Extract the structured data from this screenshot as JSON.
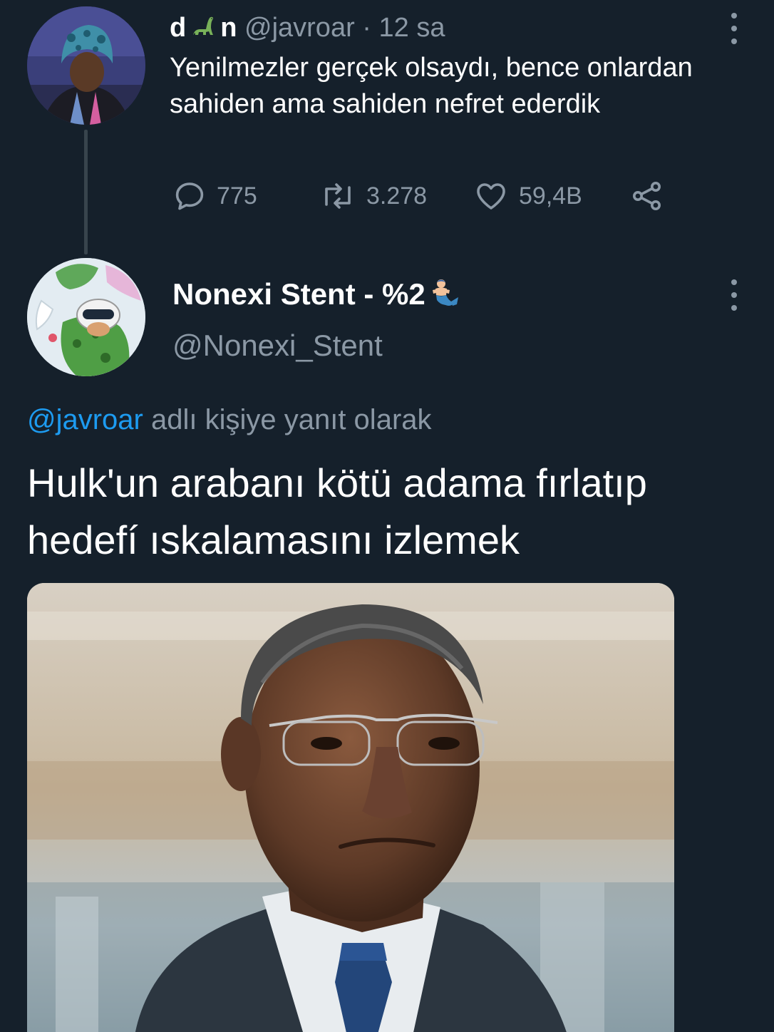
{
  "parent_tweet": {
    "name_start": "d",
    "name_emoji": "sauropod-dinosaur-icon",
    "name_end": "n",
    "handle": "@javroar",
    "separator": "·",
    "time": "12 sa",
    "text": "Yenilmezler gerçek olsaydı, bence onlardan sahiden ama sahiden nefret ederdik",
    "stats": {
      "replies": "775",
      "retweets": "3.278",
      "likes": "59,4B"
    }
  },
  "reply_tweet": {
    "name": "Nonexi Stent - %2",
    "name_emoji": "merman-icon",
    "handle": "@Nonexi_Stent",
    "reply_mention": "@javroar",
    "reply_suffix": " adlı kişiye yanıt olarak",
    "text": "Hulk'un arabanı kötü adama fırlatıp hedefí ıskalamasını izlemek",
    "media": "photo of a serious man in a dark suit and glasses in an office"
  },
  "colors": {
    "background": "#15202b",
    "secondary_text": "#8b98a5",
    "link": "#1d9bf0",
    "thread_line": "#38444d"
  }
}
